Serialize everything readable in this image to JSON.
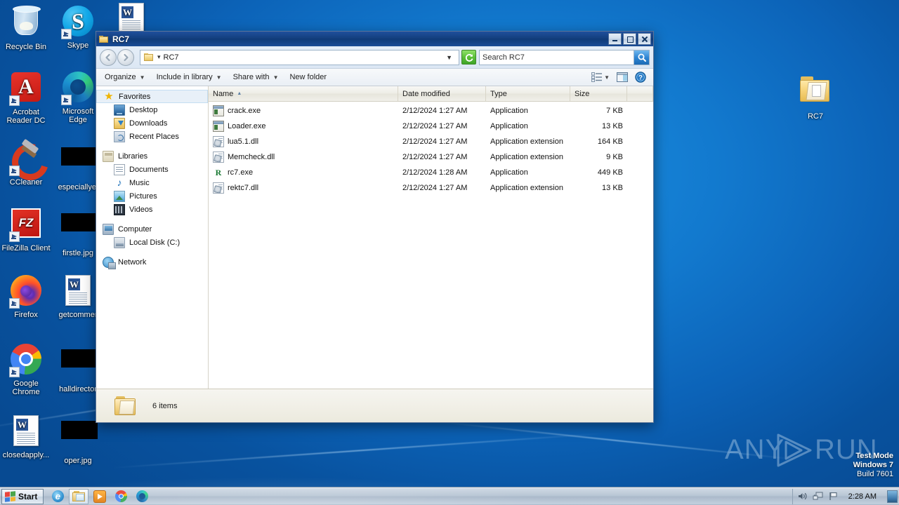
{
  "desktop": {
    "icons": [
      {
        "label": "Recycle Bin",
        "icon": "recycle-bin-icon",
        "shortcut": false
      },
      {
        "label": "Skype",
        "icon": "skype-icon",
        "shortcut": true
      },
      {
        "label": "",
        "icon": "word-document-icon",
        "shortcut": false
      },
      {
        "label": "Acrobat Reader DC",
        "icon": "acrobat-reader-icon",
        "shortcut": true
      },
      {
        "label": "Microsoft Edge",
        "icon": "microsoft-edge-icon",
        "shortcut": true
      },
      {
        "label": "CCleaner",
        "icon": "ccleaner-icon",
        "shortcut": true
      },
      {
        "label": "especiallyel",
        "icon": "redacted-thumbnail",
        "shortcut": false
      },
      {
        "label": "FileZilla Client",
        "icon": "filezilla-icon",
        "shortcut": true
      },
      {
        "label": "firstle.jpg",
        "icon": "redacted-thumbnail",
        "shortcut": false
      },
      {
        "label": "Firefox",
        "icon": "firefox-icon",
        "shortcut": true
      },
      {
        "label": "getcommer",
        "icon": "word-document-icon",
        "shortcut": false
      },
      {
        "label": "Google Chrome",
        "icon": "google-chrome-icon",
        "shortcut": true
      },
      {
        "label": "halldirector",
        "icon": "redacted-thumbnail",
        "shortcut": false
      },
      {
        "label": "closedapply...",
        "icon": "word-document-icon",
        "shortcut": false
      },
      {
        "label": "oper.jpg",
        "icon": "redacted-thumbnail",
        "shortcut": false
      },
      {
        "label": "RC7",
        "icon": "folder-icon",
        "shortcut": false
      }
    ],
    "watermark": {
      "any": "ANY",
      "run": "RUN"
    },
    "test_mode": {
      "line1": "Test Mode",
      "line2": "Windows 7",
      "line3": "Build 7601"
    }
  },
  "window": {
    "title": "RC7",
    "buttons": {
      "minimize": "Minimize",
      "maximize": "Maximize",
      "close": "Close"
    },
    "address": {
      "crumb": "RC7",
      "separator": "▾"
    },
    "search": {
      "value": "Search RC7",
      "placeholder": "Search RC7"
    },
    "toolbar": {
      "organize": "Organize",
      "include_in_library": "Include in library",
      "share_with": "Share with",
      "new_folder": "New folder",
      "caret": "▾"
    },
    "nav": {
      "groups": [
        {
          "head": {
            "label": "Favorites",
            "icon": "favorites-star-icon"
          },
          "items": [
            {
              "label": "Desktop",
              "icon": "desktop-icon"
            },
            {
              "label": "Downloads",
              "icon": "downloads-icon"
            },
            {
              "label": "Recent Places",
              "icon": "recent-places-icon"
            }
          ]
        },
        {
          "head": {
            "label": "Libraries",
            "icon": "libraries-icon"
          },
          "items": [
            {
              "label": "Documents",
              "icon": "documents-icon"
            },
            {
              "label": "Music",
              "icon": "music-icon"
            },
            {
              "label": "Pictures",
              "icon": "pictures-icon"
            },
            {
              "label": "Videos",
              "icon": "videos-icon"
            }
          ]
        },
        {
          "head": {
            "label": "Computer",
            "icon": "computer-icon"
          },
          "items": [
            {
              "label": "Local Disk (C:)",
              "icon": "local-disk-icon"
            }
          ]
        },
        {
          "head": {
            "label": "Network",
            "icon": "network-icon"
          },
          "items": []
        }
      ]
    },
    "columns": [
      {
        "label": "Name",
        "sorted": true,
        "sort_dir": "▲"
      },
      {
        "label": "Date modified",
        "sorted": false,
        "sort_dir": ""
      },
      {
        "label": "Type",
        "sorted": false,
        "sort_dir": ""
      },
      {
        "label": "Size",
        "sorted": false,
        "sort_dir": ""
      }
    ],
    "files": [
      {
        "name": "crack.exe",
        "date": "2/12/2024 1:27 AM",
        "type": "Application",
        "size": "7 KB",
        "icon": "exe-file-icon"
      },
      {
        "name": "Loader.exe",
        "date": "2/12/2024 1:27 AM",
        "type": "Application",
        "size": "13 KB",
        "icon": "exe-file-icon"
      },
      {
        "name": "lua5.1.dll",
        "date": "2/12/2024 1:27 AM",
        "type": "Application extension",
        "size": "164 KB",
        "icon": "dll-file-icon"
      },
      {
        "name": "Memcheck.dll",
        "date": "2/12/2024 1:27 AM",
        "type": "Application extension",
        "size": "9 KB",
        "icon": "dll-file-icon"
      },
      {
        "name": "rc7.exe",
        "date": "2/12/2024 1:28 AM",
        "type": "Application",
        "size": "449 KB",
        "icon": "rc7-file-icon"
      },
      {
        "name": "rektc7.dll",
        "date": "2/12/2024 1:27 AM",
        "type": "Application extension",
        "size": "13 KB",
        "icon": "dll-file-icon"
      }
    ],
    "status": {
      "items": "6 items"
    }
  },
  "taskbar": {
    "start": "Start",
    "buttons": [
      {
        "name": "internet-explorer",
        "active": false
      },
      {
        "name": "windows-explorer",
        "active": true
      },
      {
        "name": "windows-media-player",
        "active": false
      },
      {
        "name": "google-chrome",
        "active": false
      },
      {
        "name": "microsoft-edge",
        "active": false
      }
    ],
    "tray": {
      "clock": "2:28 AM"
    }
  }
}
